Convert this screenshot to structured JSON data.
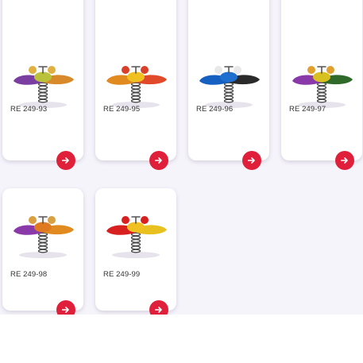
{
  "products": [
    {
      "code": "RE 249-93",
      "colors": {
        "body": "#b9c23a",
        "wing1": "#7a3ea0",
        "wing2": "#d88a2a",
        "head": "#e0b040"
      }
    },
    {
      "code": "RE 249-95",
      "colors": {
        "body": "#f0c020",
        "wing1": "#e08a20",
        "wing2": "#e04a2a",
        "head": "#d8402a"
      }
    },
    {
      "code": "RE 249-96",
      "colors": {
        "body": "#1e6fd0",
        "wing1": "#1560c0",
        "wing2": "#2a2a2a",
        "head": "#e8e8e8"
      }
    },
    {
      "code": "RE 249-97",
      "colors": {
        "body": "#d8c020",
        "wing1": "#8a3aa8",
        "wing2": "#2f6a2a",
        "head": "#e0a030"
      }
    },
    {
      "code": "RE 249-98",
      "colors": {
        "body": "#e07a20",
        "wing1": "#8a3aa8",
        "wing2": "#e08a20",
        "head": "#d8a040"
      }
    },
    {
      "code": "RE 249-99",
      "colors": {
        "body": "#f0c020",
        "wing1": "#d82020",
        "wing2": "#e8c020",
        "head": "#d82020"
      }
    }
  ],
  "accent": "#e0203a",
  "icons": {
    "card_action": "arrow-right-icon",
    "corner": "leaf-logo-icon"
  }
}
